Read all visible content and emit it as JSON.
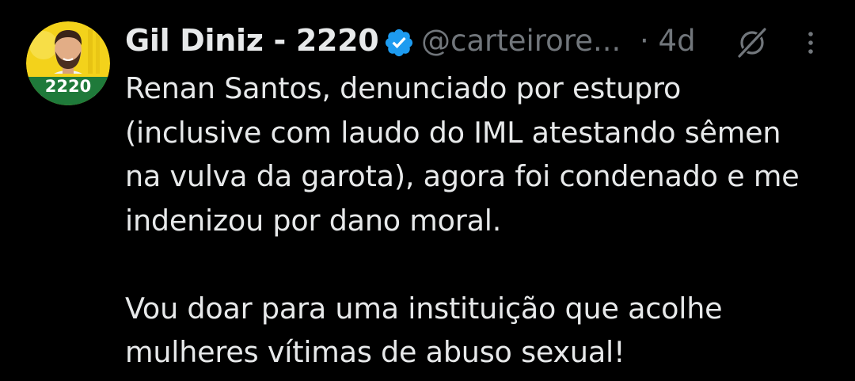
{
  "tweet": {
    "display_name": "Gil Diniz - 2220",
    "handle": "@carteirore...",
    "time": "· 4d",
    "avatar_badge": "2220",
    "verified": true,
    "body": "Renan Santos, denunciado por estupro\n(inclusive com laudo do IML atestando sêmen\nna vulva da garota), agora foi condenado e me\nindenizou por dano moral.\n\nVou doar para uma instituição que acolhe\nmulheres vítimas de abuso sexual!"
  },
  "icons": {
    "verified": "verified-badge-icon",
    "grok": "grok-icon",
    "more": "more-options-icon"
  },
  "colors": {
    "background": "#000000",
    "text_primary": "#e7e9ea",
    "text_secondary": "#71767b",
    "verified_blue": "#1d9bf0",
    "avatar_yellow": "#f3d21b",
    "avatar_green": "#1f7a3a"
  }
}
